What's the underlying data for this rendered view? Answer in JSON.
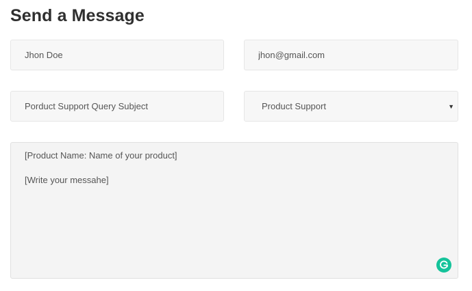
{
  "form": {
    "title": "Send a Message",
    "name_value": "Jhon Doe",
    "email_value": "jhon@gmail.com",
    "subject_value": "Porduct Support Query Subject",
    "department_selected": "Product Support",
    "message_line1": "[Product Name: Name of your product]",
    "message_line2": "[Write your messahe]"
  },
  "icons": {
    "select_caret": "▼",
    "grammarly": "grammarly-icon"
  },
  "colors": {
    "field_bg": "#f7f7f7",
    "textarea_bg": "#f4f4f4",
    "grammarly_green": "#15c39a"
  }
}
